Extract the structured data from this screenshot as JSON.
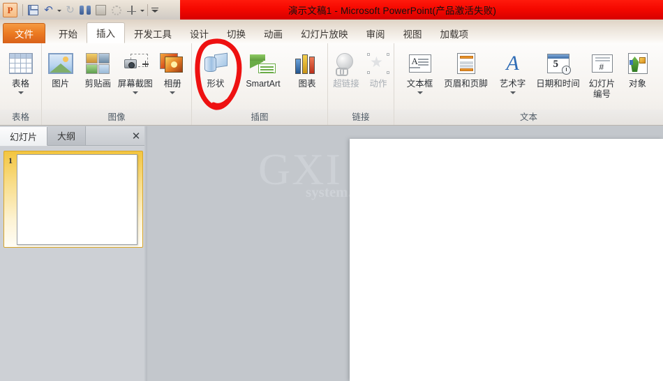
{
  "window": {
    "title": "演示文稿1 - Microsoft PowerPoint(产品激活失败)",
    "title_color": "#f50800"
  },
  "quick_access": {
    "items": [
      {
        "name": "powerpoint-logo",
        "glyph": "P"
      },
      {
        "name": "save-icon",
        "label": "保存"
      },
      {
        "name": "undo-icon",
        "label": "撤消",
        "glyph": "↰"
      },
      {
        "name": "undo-dropdown",
        "label": "撤消下拉"
      },
      {
        "name": "redo-icon",
        "label": "恢复",
        "glyph": "↻",
        "disabled": true
      },
      {
        "name": "find-icon",
        "label": "查找"
      },
      {
        "name": "clipboard-icon",
        "label": "剪贴板"
      },
      {
        "name": "shape-circle-icon",
        "label": "形状"
      },
      {
        "name": "align-icon",
        "label": "对齐"
      },
      {
        "name": "customize-qat-dropdown",
        "label": "自定义快速访问工具栏"
      }
    ]
  },
  "ribbon": {
    "tabs": [
      {
        "label": "文件",
        "type": "file",
        "active": false
      },
      {
        "label": "开始",
        "type": "normal",
        "active": false
      },
      {
        "label": "插入",
        "type": "normal",
        "active": true
      },
      {
        "label": "开发工具",
        "type": "normal",
        "active": false
      },
      {
        "label": "设计",
        "type": "normal",
        "active": false
      },
      {
        "label": "切换",
        "type": "normal",
        "active": false
      },
      {
        "label": "动画",
        "type": "normal",
        "active": false
      },
      {
        "label": "幻灯片放映",
        "type": "normal",
        "active": false
      },
      {
        "label": "审阅",
        "type": "normal",
        "active": false
      },
      {
        "label": "视图",
        "type": "normal",
        "active": false
      },
      {
        "label": "加载项",
        "type": "normal",
        "active": false
      }
    ],
    "groups": [
      {
        "name": "table",
        "label": "表格",
        "buttons": [
          {
            "label": "表格",
            "icon": "table-icon",
            "dropdown": true,
            "disabled": false
          }
        ]
      },
      {
        "name": "images",
        "label": "图像",
        "buttons": [
          {
            "label": "图片",
            "icon": "picture-icon",
            "dropdown": false,
            "disabled": false
          },
          {
            "label": "剪贴画",
            "icon": "clipart-icon",
            "dropdown": false,
            "disabled": false
          },
          {
            "label": "屏幕截图",
            "icon": "screenshot-icon",
            "dropdown": true,
            "disabled": false
          },
          {
            "label": "相册",
            "icon": "photo-album-icon",
            "dropdown": true,
            "disabled": false
          }
        ]
      },
      {
        "name": "illustrations",
        "label": "插图",
        "buttons": [
          {
            "label": "形状",
            "icon": "shapes-icon",
            "dropdown": false,
            "disabled": false,
            "annotated": true
          },
          {
            "label": "SmartArt",
            "icon": "smartart-icon",
            "dropdown": false,
            "disabled": false
          },
          {
            "label": "图表",
            "icon": "chart-icon",
            "dropdown": false,
            "disabled": false
          }
        ]
      },
      {
        "name": "links",
        "label": "链接",
        "buttons": [
          {
            "label": "超链接",
            "icon": "hyperlink-icon",
            "dropdown": false,
            "disabled": true
          },
          {
            "label": "动作",
            "icon": "action-icon",
            "dropdown": false,
            "disabled": true
          }
        ]
      },
      {
        "name": "text",
        "label": "文本",
        "buttons": [
          {
            "label": "文本框",
            "icon": "textbox-icon",
            "dropdown": true,
            "disabled": false
          },
          {
            "label": "页眉和页脚",
            "icon": "header-footer-icon",
            "dropdown": false,
            "disabled": false
          },
          {
            "label": "艺术字",
            "icon": "wordart-icon",
            "dropdown": true,
            "disabled": false
          },
          {
            "label": "日期和时间",
            "icon": "date-time-icon",
            "dropdown": false,
            "disabled": false
          },
          {
            "label": "幻灯片编号",
            "icon": "slide-number-icon",
            "dropdown": false,
            "disabled": false,
            "wrap": true
          },
          {
            "label": "对象",
            "icon": "object-icon",
            "dropdown": false,
            "disabled": false
          }
        ]
      }
    ]
  },
  "annotation": {
    "name": "red-circle-annotation",
    "color": "#ee1111",
    "target": "形状"
  },
  "slide_panel": {
    "tabs": [
      {
        "label": "幻灯片",
        "active": true
      },
      {
        "label": "大纲",
        "active": false
      }
    ],
    "close_label": "✕",
    "thumbnails": [
      {
        "number": "1",
        "selected": true
      }
    ]
  },
  "workspace": {
    "watermark_primary": "GXI",
    "watermark_secondary": "system.c",
    "slide_background": "#ffffff"
  }
}
